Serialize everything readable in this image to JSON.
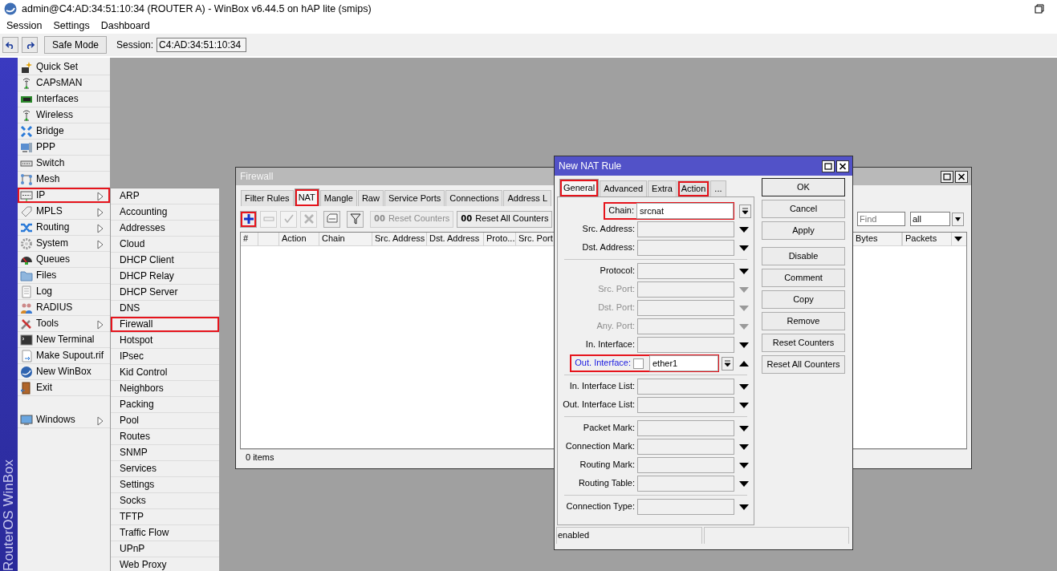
{
  "window": {
    "title": "admin@C4:AD:34:51:10:34 (ROUTER A) - WinBox v6.44.5 on hAP lite (smips)"
  },
  "menu_bar": [
    "Session",
    "Settings",
    "Dashboard"
  ],
  "toolbar": {
    "safe_mode": "Safe Mode",
    "session_label": "Session:",
    "session_value": "C4:AD:34:51:10:34"
  },
  "sidebar": {
    "brand": "RouterOS WinBox",
    "items": [
      {
        "label": "Quick Set",
        "submenu": false,
        "highlighted": false
      },
      {
        "label": "CAPsMAN",
        "submenu": false,
        "highlighted": false
      },
      {
        "label": "Interfaces",
        "submenu": false,
        "highlighted": false
      },
      {
        "label": "Wireless",
        "submenu": false,
        "highlighted": false
      },
      {
        "label": "Bridge",
        "submenu": false,
        "highlighted": false
      },
      {
        "label": "PPP",
        "submenu": false,
        "highlighted": false
      },
      {
        "label": "Switch",
        "submenu": false,
        "highlighted": false
      },
      {
        "label": "Mesh",
        "submenu": false,
        "highlighted": false
      },
      {
        "label": "IP",
        "submenu": true,
        "highlighted": true
      },
      {
        "label": "MPLS",
        "submenu": true,
        "highlighted": false
      },
      {
        "label": "Routing",
        "submenu": true,
        "highlighted": false
      },
      {
        "label": "System",
        "submenu": true,
        "highlighted": false
      },
      {
        "label": "Queues",
        "submenu": false,
        "highlighted": false
      },
      {
        "label": "Files",
        "submenu": false,
        "highlighted": false
      },
      {
        "label": "Log",
        "submenu": false,
        "highlighted": false
      },
      {
        "label": "RADIUS",
        "submenu": false,
        "highlighted": false
      },
      {
        "label": "Tools",
        "submenu": true,
        "highlighted": false
      },
      {
        "label": "New Terminal",
        "submenu": false,
        "highlighted": false
      },
      {
        "label": "Make Supout.rif",
        "submenu": false,
        "highlighted": false
      },
      {
        "label": "New WinBox",
        "submenu": false,
        "highlighted": false
      },
      {
        "label": "Exit",
        "submenu": false,
        "highlighted": false
      }
    ],
    "bottom_items": [
      {
        "label": "Windows",
        "submenu": true,
        "highlighted": false
      }
    ]
  },
  "ip_submenu": {
    "items": [
      {
        "label": "ARP",
        "highlighted": false
      },
      {
        "label": "Accounting",
        "highlighted": false
      },
      {
        "label": "Addresses",
        "highlighted": false
      },
      {
        "label": "Cloud",
        "highlighted": false
      },
      {
        "label": "DHCP Client",
        "highlighted": false
      },
      {
        "label": "DHCP Relay",
        "highlighted": false
      },
      {
        "label": "DHCP Server",
        "highlighted": false
      },
      {
        "label": "DNS",
        "highlighted": false
      },
      {
        "label": "Firewall",
        "highlighted": true
      },
      {
        "label": "Hotspot",
        "highlighted": false
      },
      {
        "label": "IPsec",
        "highlighted": false
      },
      {
        "label": "Kid Control",
        "highlighted": false
      },
      {
        "label": "Neighbors",
        "highlighted": false
      },
      {
        "label": "Packing",
        "highlighted": false
      },
      {
        "label": "Pool",
        "highlighted": false
      },
      {
        "label": "Routes",
        "highlighted": false
      },
      {
        "label": "SNMP",
        "highlighted": false
      },
      {
        "label": "Services",
        "highlighted": false
      },
      {
        "label": "Settings",
        "highlighted": false
      },
      {
        "label": "Socks",
        "highlighted": false
      },
      {
        "label": "TFTP",
        "highlighted": false
      },
      {
        "label": "Traffic Flow",
        "highlighted": false
      },
      {
        "label": "UPnP",
        "highlighted": false
      },
      {
        "label": "Web Proxy",
        "highlighted": false
      }
    ]
  },
  "firewall": {
    "title": "Firewall",
    "tabs": [
      {
        "label": "Filter Rules",
        "selected": false,
        "highlighted": false
      },
      {
        "label": "NAT",
        "selected": true,
        "highlighted": true
      },
      {
        "label": "Mangle",
        "selected": false,
        "highlighted": false
      },
      {
        "label": "Raw",
        "selected": false,
        "highlighted": false
      },
      {
        "label": "Service Ports",
        "selected": false,
        "highlighted": false
      },
      {
        "label": "Connections",
        "selected": false,
        "highlighted": false
      },
      {
        "label": "Address L",
        "selected": false,
        "highlighted": false
      }
    ],
    "tools": [
      {
        "kind": "add",
        "disabled": false,
        "highlighted": true
      },
      {
        "kind": "remove",
        "disabled": true
      },
      {
        "kind": "enable",
        "disabled": true
      },
      {
        "kind": "disable",
        "disabled": true
      },
      {
        "kind": "comment",
        "disabled": false
      },
      {
        "kind": "filter",
        "disabled": false
      }
    ],
    "counter_buttons": [
      {
        "prefix": "00",
        "label": "Reset Counters",
        "disabled": true
      },
      {
        "prefix": "00",
        "label": "Reset All Counters",
        "disabled": false
      }
    ],
    "find": {
      "placeholder": "Find"
    },
    "scope": "all",
    "columns": [
      {
        "kind": "text",
        "label": "#"
      },
      {
        "kind": "blank"
      },
      {
        "kind": "text",
        "label": "Action"
      },
      {
        "kind": "text",
        "label": "Chain"
      },
      {
        "kind": "text",
        "label": "Src. Address"
      },
      {
        "kind": "text",
        "label": "Dst. Address"
      },
      {
        "kind": "text",
        "label": "Proto..."
      },
      {
        "kind": "text",
        "label": "Src. Port"
      }
    ],
    "columns_right": [
      "Bytes",
      "Packets"
    ],
    "status": "0 items"
  },
  "nat_rule": {
    "title": "New NAT Rule",
    "tabs": [
      {
        "label": "General",
        "selected": true,
        "highlighted": true
      },
      {
        "label": "Advanced",
        "selected": false,
        "highlighted": false
      },
      {
        "label": "Extra",
        "selected": false,
        "highlighted": false
      },
      {
        "label": "Action",
        "selected": false,
        "highlighted": true
      },
      {
        "label": "...",
        "selected": false,
        "highlighted": false
      }
    ],
    "groups": [
      {
        "fields": [
          {
            "kind": "select",
            "label": "Chain:",
            "value": "srcnat",
            "disabled": false,
            "active": false,
            "highlighted": true
          },
          {
            "kind": "optional",
            "label": "Src. Address:",
            "disabled": false,
            "active": false,
            "highlighted": false
          },
          {
            "kind": "optional",
            "label": "Dst. Address:",
            "disabled": false,
            "active": false,
            "highlighted": false
          }
        ]
      },
      {
        "fields": [
          {
            "kind": "optional",
            "label": "Protocol:",
            "disabled": false,
            "active": false,
            "highlighted": false
          },
          {
            "kind": "optional",
            "label": "Src. Port:",
            "disabled": true,
            "active": false,
            "highlighted": false
          },
          {
            "kind": "optional",
            "label": "Dst. Port:",
            "disabled": true,
            "active": false,
            "highlighted": false
          },
          {
            "kind": "optional",
            "label": "Any. Port:",
            "disabled": true,
            "active": false,
            "highlighted": false
          },
          {
            "kind": "optional",
            "label": "In. Interface:",
            "disabled": false,
            "active": false,
            "highlighted": false
          },
          {
            "kind": "negatable",
            "label": "Out. Interface:",
            "value": "ether1",
            "checked": false,
            "disabled": false,
            "active": true,
            "highlighted": true
          }
        ]
      },
      {
        "fields": [
          {
            "kind": "optional",
            "label": "In. Interface List:",
            "disabled": false,
            "active": false,
            "highlighted": false
          },
          {
            "kind": "optional",
            "label": "Out. Interface List:",
            "disabled": false,
            "active": false,
            "highlighted": false
          }
        ]
      },
      {
        "fields": [
          {
            "kind": "optional",
            "label": "Packet Mark:",
            "disabled": false,
            "active": false,
            "highlighted": false
          },
          {
            "kind": "optional",
            "label": "Connection Mark:",
            "disabled": false,
            "active": false,
            "highlighted": false
          },
          {
            "kind": "optional",
            "label": "Routing Mark:",
            "disabled": false,
            "active": false,
            "highlighted": false
          },
          {
            "kind": "optional",
            "label": "Routing Table:",
            "disabled": false,
            "active": false,
            "highlighted": false
          }
        ]
      },
      {
        "fields": [
          {
            "kind": "optional",
            "label": "Connection Type:",
            "disabled": false,
            "active": false,
            "highlighted": false
          }
        ]
      }
    ],
    "buttons": [
      [
        {
          "label": "OK",
          "default": true
        },
        {
          "label": "Cancel",
          "default": false
        },
        {
          "label": "Apply",
          "default": false
        }
      ],
      [
        {
          "label": "Disable",
          "default": false
        },
        {
          "label": "Comment",
          "default": false
        },
        {
          "label": "Copy",
          "default": false
        },
        {
          "label": "Remove",
          "default": false
        },
        {
          "label": "Reset Counters",
          "default": false
        },
        {
          "label": "Reset All Counters",
          "default": false
        }
      ]
    ],
    "status": [
      "enabled"
    ]
  }
}
